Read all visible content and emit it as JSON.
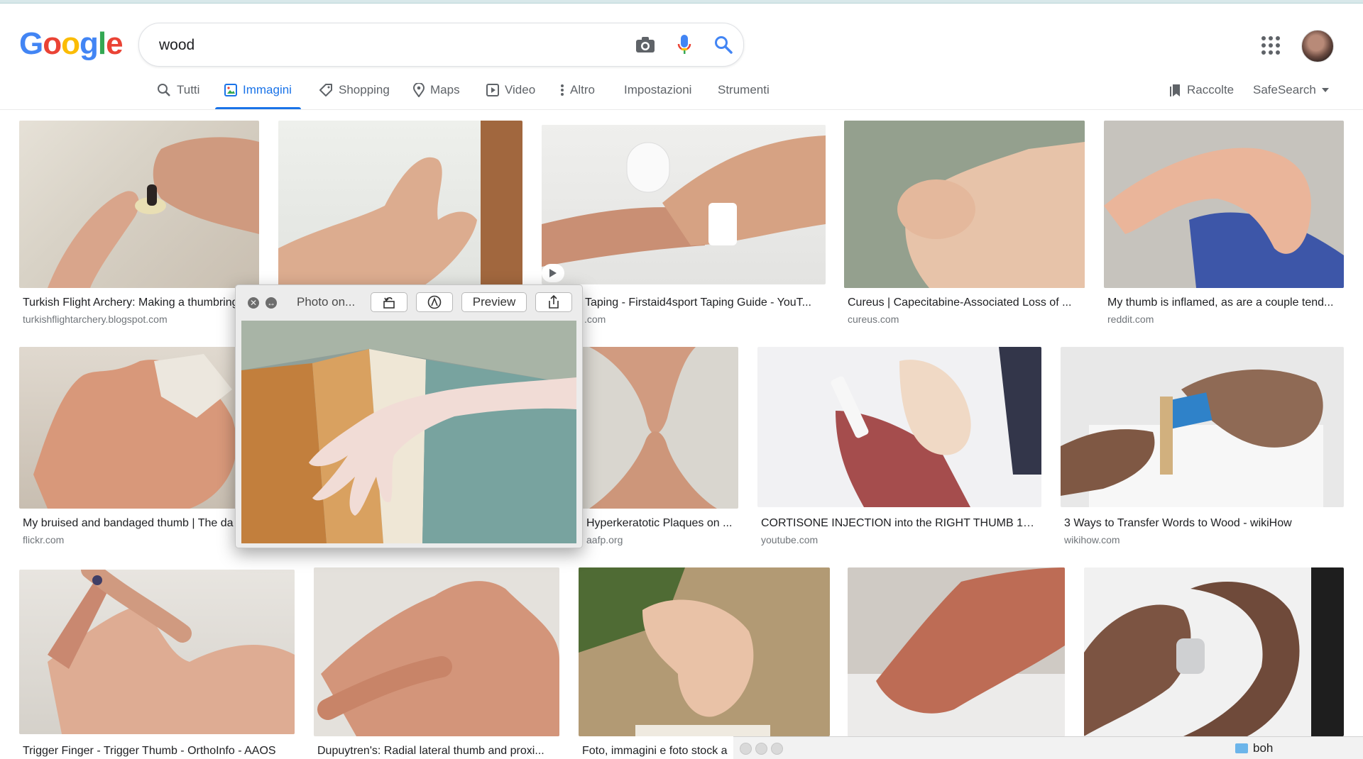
{
  "header": {
    "logo": [
      "G",
      "o",
      "o",
      "g",
      "l",
      "e"
    ],
    "logo_colors": [
      "#4285f4",
      "#ea4335",
      "#fbbc05",
      "#4285f4",
      "#34a853",
      "#ea4335"
    ],
    "search_value": "wood",
    "camera_icon": "camera-icon",
    "mic_icon": "microphone-icon",
    "search_icon": "search-icon",
    "apps_icon": "apps-grid-icon"
  },
  "tabs": {
    "all": "Tutti",
    "images": "Immagini",
    "shopping": "Shopping",
    "maps": "Maps",
    "video": "Video",
    "more": "Altro",
    "settings": "Impostazioni",
    "tools": "Strumenti",
    "collections": "Raccolte",
    "safesearch": "SafeSearch"
  },
  "results": [
    {
      "caption": "Turkish Flight Archery: Making a thumbring",
      "source": "turkishflightarchery.blogspot.com"
    },
    {
      "caption": "",
      "source": ""
    },
    {
      "caption": "Taping - Firstaid4sport Taping Guide - YouT...",
      "source": ".com"
    },
    {
      "caption": "Cureus | Capecitabine-Associated Loss of ...",
      "source": "cureus.com"
    },
    {
      "caption": "My thumb is inflamed, as are a couple tend...",
      "source": "reddit.com"
    },
    {
      "caption": "My bruised and bandaged thumb | The da",
      "source": "flickr.com"
    },
    {
      "caption": "Hyperkeratotic Plaques on ...",
      "source": "aafp.org"
    },
    {
      "caption": "CORTISONE INJECTION into the RIGHT THUMB 10/...",
      "source": "youtube.com"
    },
    {
      "caption": "3 Ways to Transfer Words to Wood - wikiHow",
      "source": "wikihow.com"
    },
    {
      "caption": "Trigger Finger - Trigger Thumb - OrthoInfo - AAOS",
      "source": ""
    },
    {
      "caption": "Dupuytren's: Radial lateral thumb and proxi...",
      "source": ""
    },
    {
      "caption": "Foto, immagini e foto stock a",
      "source": ""
    }
  ],
  "popup": {
    "title": "Photo on...",
    "preview_button": "Preview"
  },
  "finder": {
    "folder_name": "boh"
  }
}
